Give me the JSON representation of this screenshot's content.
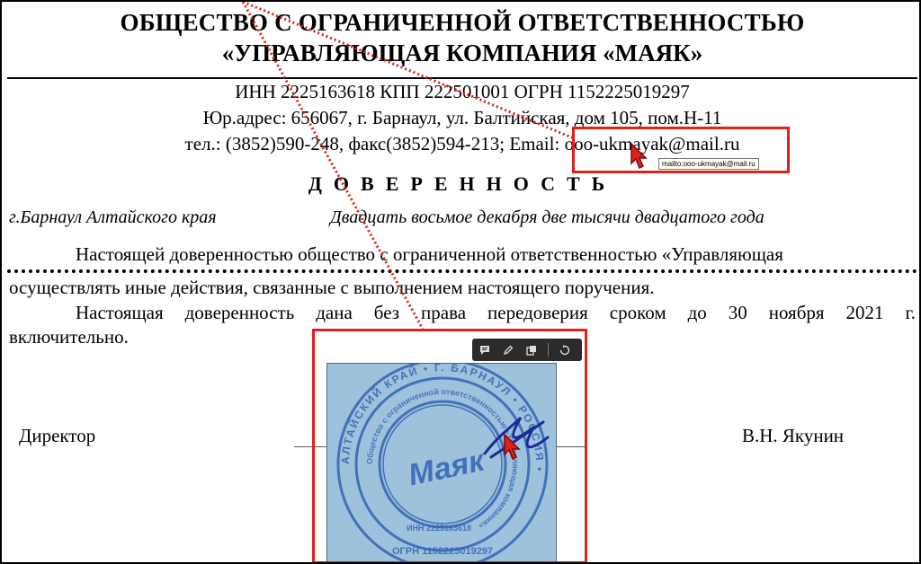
{
  "header": {
    "title_line1": "ОБЩЕСТВО С ОГРАНИЧЕННОЙ ОТВЕТСТВЕННОСТЬЮ",
    "title_line2": "«УПРАВЛЯЮЩАЯ КОМПАНИЯ «МАЯК»",
    "inn_line": "ИНН 2225163618 КПП 222501001 ОГРН 1152225019297",
    "address_line": "Юр.адрес: 656067, г. Барнаул, ул. Балтийская, дом 105, пом.Н-11",
    "contacts_prefix": "тел.: (3852)590-248, факс(3852)594-213; Email: ",
    "email": "ooo-ukmayak@mail.ru",
    "email_tooltip": "mailto:ooo-ukmayak@mail.ru"
  },
  "document": {
    "heading": "ДОВЕРЕННОСТЬ",
    "city": "г.Барнаул Алтайского края",
    "date": "Двадцать восьмое декабря две тысячи двадцатого года",
    "paragraph1": "Настоящей доверенностью общество с ограниченной ответственностью «Управляющая",
    "paragraph2": "осуществлять иные действия, связанные с выполнением настоящего поручения.",
    "paragraph3_line1": "Настоящая доверенность дана без права передоверия сроком до 30 ноября 2021 г.",
    "paragraph3_line2": "включительно.",
    "position": "Директор",
    "signer": "В.Н. Якунин"
  },
  "stamp": {
    "center_text": "Маяк",
    "outer_ring_text": "АЛТАЙСКИЙ КРАЙ • Г. БАРНАУЛ • РОССИЯ •",
    "ogrn_text": "ОГРН 1152225019297",
    "inn_text": "ИНН 2225163618",
    "inner_ring_text": "Общество с ограниченной ответственностью «Управляющая компания»"
  },
  "toolbar": {
    "icons": [
      "comment-icon",
      "pen-icon",
      "copy-icon",
      "rotate-icon"
    ]
  },
  "colors": {
    "highlight_red": "#e0201b",
    "stamp_blue": "#2f5fb8",
    "stamp_bg": "#9ec2dc",
    "toolbar_bg": "#2b2b2b"
  }
}
